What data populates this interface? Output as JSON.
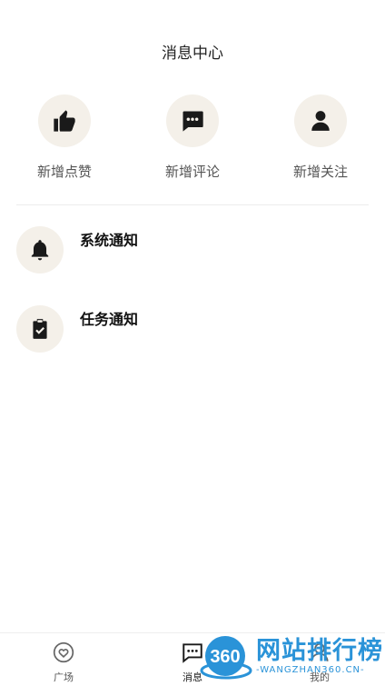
{
  "header": {
    "title": "消息中心"
  },
  "quick_actions": [
    {
      "label": "新增点赞",
      "icon": "thumb-up-icon"
    },
    {
      "label": "新增评论",
      "icon": "comment-icon"
    },
    {
      "label": "新增关注",
      "icon": "person-icon"
    }
  ],
  "notices": [
    {
      "title": "系统通知",
      "icon": "bell-icon"
    },
    {
      "title": "任务通知",
      "icon": "clipboard-check-icon"
    }
  ],
  "tabbar": {
    "items": [
      {
        "label": "广场",
        "icon": "heart-chat-icon"
      },
      {
        "label": "消息",
        "icon": "message-icon"
      },
      {
        "label": "我的",
        "icon": "person-icon"
      }
    ]
  },
  "watermark": {
    "title": "网站排行榜",
    "subtitle": "-WANGZHAN360.CN-",
    "logo_text": "360"
  },
  "colors": {
    "icon_bg": "#f4f0e9",
    "icon_fg": "#1a1a1a",
    "watermark": "#2a93d8"
  }
}
